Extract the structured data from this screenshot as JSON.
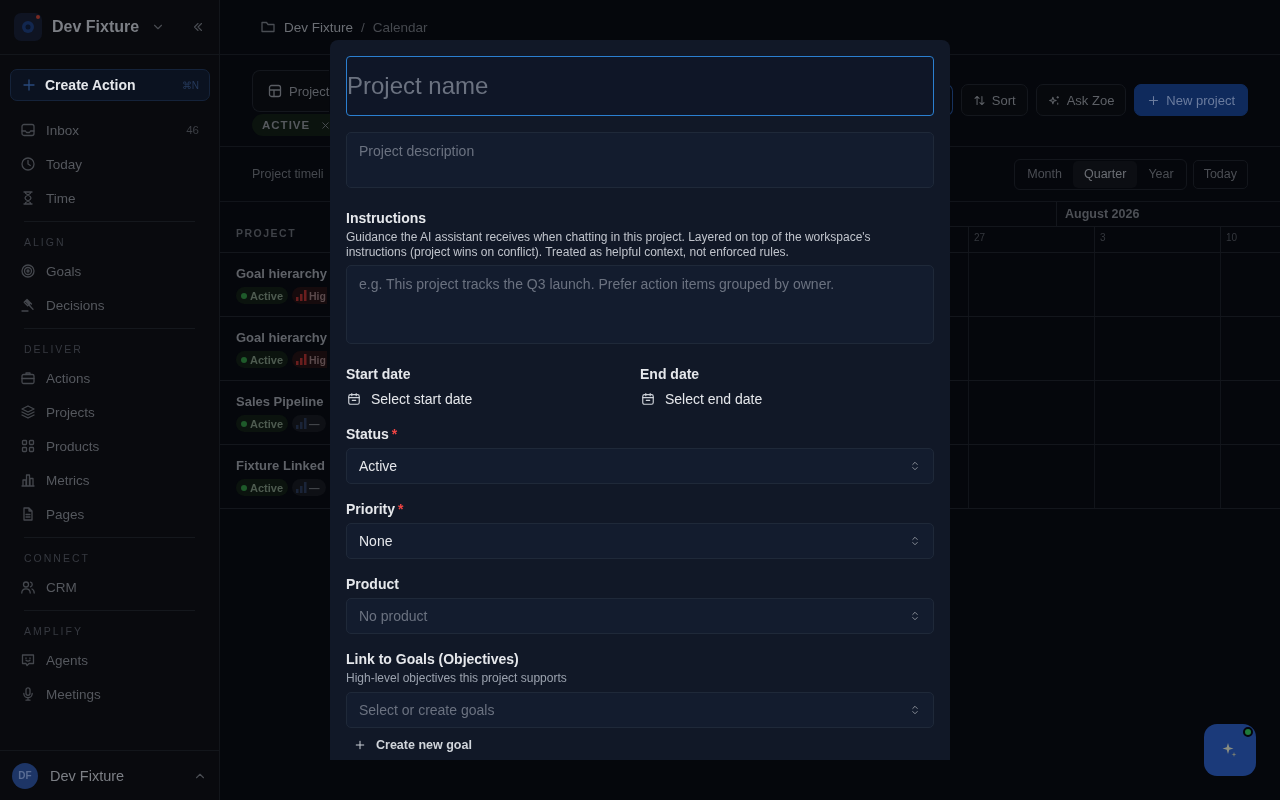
{
  "sidebar": {
    "workspace": "Dev Fixture",
    "create_action": {
      "label": "Create Action",
      "shortcut": "⌘N"
    },
    "sections": [
      {
        "items": [
          {
            "label": "Inbox",
            "count": "46"
          },
          {
            "label": "Today"
          },
          {
            "label": "Time"
          }
        ]
      },
      {
        "title": "ALIGN",
        "items": [
          {
            "label": "Goals"
          },
          {
            "label": "Decisions"
          }
        ]
      },
      {
        "title": "DELIVER",
        "items": [
          {
            "label": "Actions"
          },
          {
            "label": "Projects"
          },
          {
            "label": "Products"
          },
          {
            "label": "Metrics"
          },
          {
            "label": "Pages"
          }
        ]
      },
      {
        "title": "CONNECT",
        "items": [
          {
            "label": "CRM"
          }
        ]
      },
      {
        "title": "AMPLIFY",
        "items": [
          {
            "label": "Agents"
          },
          {
            "label": "Meetings"
          }
        ]
      }
    ],
    "user": {
      "initials": "DF",
      "name": "Dev Fixture"
    }
  },
  "breadcrumb": {
    "items": [
      "Dev Fixture",
      "Calendar"
    ],
    "separator": "/"
  },
  "toolbar": {
    "view_button": "Project",
    "filter_chip": "ACTIVE",
    "buttons": [
      {
        "kind": "sort",
        "label": "Sort"
      },
      {
        "kind": "ask",
        "label": "Ask Zoe"
      },
      {
        "kind": "primary",
        "label": "New project"
      }
    ]
  },
  "timeline": {
    "caption": "Project timeli",
    "ranges": [
      {
        "label": "Month",
        "selected": false
      },
      {
        "label": "Quarter",
        "selected": true
      },
      {
        "label": "Year",
        "selected": false
      }
    ],
    "today": "Today",
    "column": "PROJECT",
    "month": "August 2026",
    "weeks": [
      "27",
      "3",
      "10"
    ],
    "rows": [
      {
        "name": "Goal hierarchy",
        "status": "Active",
        "priority": {
          "kind": "high",
          "label": "Hig"
        }
      },
      {
        "name": "Goal hierarchy",
        "status": "Active",
        "priority": {
          "kind": "high",
          "label": "Hig"
        }
      },
      {
        "name": "Sales Pipeline",
        "status": "Active",
        "priority": {
          "kind": "none",
          "label": "—"
        }
      },
      {
        "name": "Fixture Linked",
        "status": "Active",
        "priority": {
          "kind": "none",
          "label": "—"
        }
      }
    ]
  },
  "modal": {
    "name_placeholder": "Project name",
    "description_placeholder": "Project description",
    "instructions": {
      "label": "Instructions",
      "help": "Guidance the AI assistant receives when chatting in this project. Layered on top of the workspace's instructions (project wins on conflict). Treated as helpful context, not enforced rules.",
      "placeholder": "e.g. This project tracks the Q3 launch. Prefer action items grouped by owner."
    },
    "dates": [
      {
        "label": "Start date",
        "button": "Select start date"
      },
      {
        "label": "End date",
        "button": "Select end date"
      }
    ],
    "selects": [
      {
        "label": "Status",
        "required_mark": "*",
        "value": "Active"
      },
      {
        "label": "Priority",
        "required_mark": "*",
        "value": "None"
      },
      {
        "label": "Product",
        "placeholder": "No product"
      },
      {
        "label": "Link to Goals (Objectives)",
        "help": "High-level objectives this project supports",
        "placeholder": "Select or create goals"
      }
    ],
    "create_goal": "Create new goal"
  }
}
